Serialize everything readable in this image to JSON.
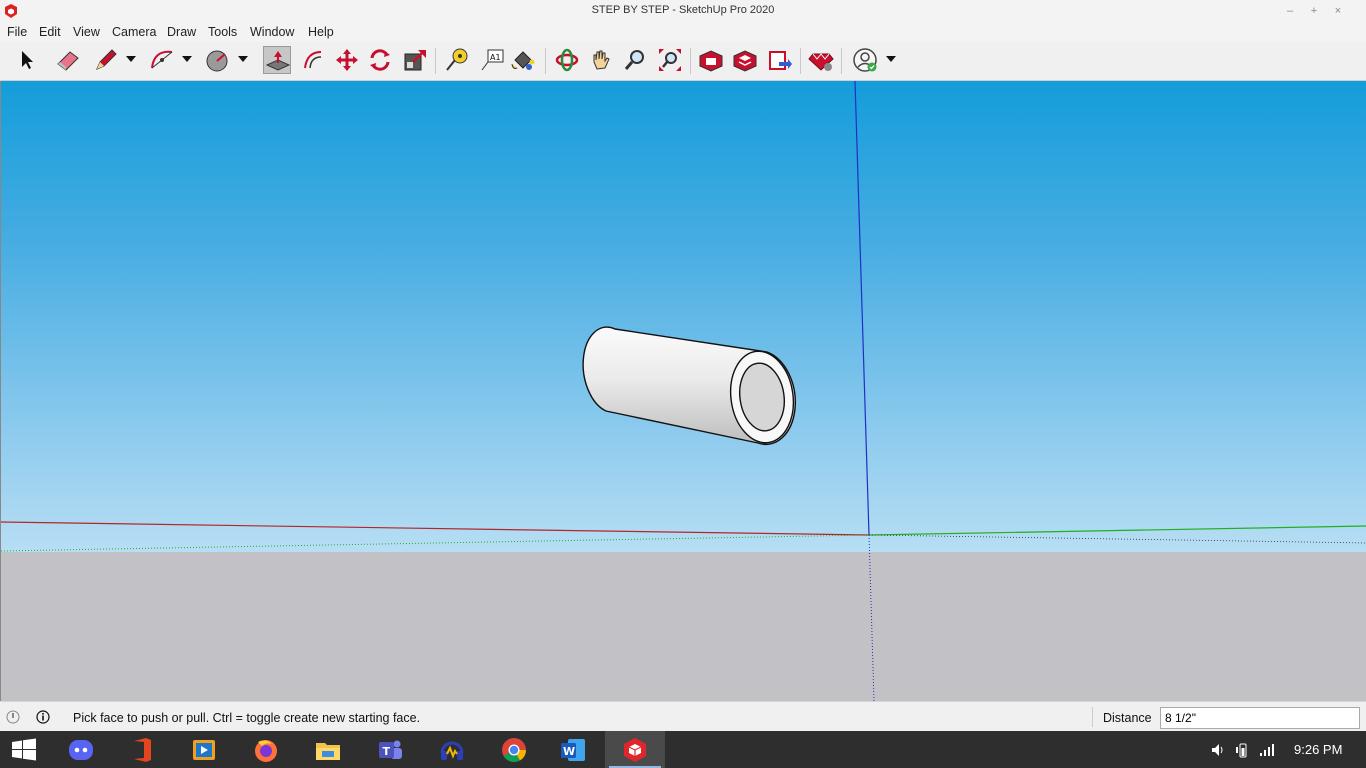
{
  "window": {
    "title": "STEP BY STEP - SketchUp Pro 2020"
  },
  "menu": [
    "File",
    "Edit",
    "View",
    "Camera",
    "Draw",
    "Tools",
    "Window",
    "Help"
  ],
  "toolbar": {
    "tools": [
      {
        "name": "select",
        "icon": "select-arrow-icon"
      },
      {
        "name": "eraser",
        "icon": "eraser-icon"
      },
      {
        "name": "line",
        "icon": "pencil-icon"
      },
      {
        "name": "arc",
        "icon": "arc-icon"
      },
      {
        "name": "shapes",
        "icon": "circle-shape-icon"
      },
      {
        "name": "push-pull",
        "icon": "push-pull-icon",
        "active": true
      },
      {
        "name": "offset",
        "icon": "offset-icon"
      },
      {
        "name": "move",
        "icon": "move-icon"
      },
      {
        "name": "rotate",
        "icon": "rotate-icon"
      },
      {
        "name": "scale",
        "icon": "scale-icon"
      },
      {
        "name": "tape-measure",
        "icon": "tape-measure-icon"
      },
      {
        "name": "text",
        "icon": "text-icon"
      },
      {
        "name": "paint-bucket",
        "icon": "paint-bucket-icon"
      },
      {
        "name": "orbit",
        "icon": "orbit-icon"
      },
      {
        "name": "pan",
        "icon": "pan-hand-icon"
      },
      {
        "name": "zoom",
        "icon": "zoom-icon"
      },
      {
        "name": "zoom-extents",
        "icon": "zoom-extents-icon"
      },
      {
        "name": "3d-warehouse",
        "icon": "warehouse-icon"
      },
      {
        "name": "extension-warehouse",
        "icon": "extension-warehouse-icon"
      },
      {
        "name": "send-to-layout",
        "icon": "layout-icon"
      },
      {
        "name": "extension-manager",
        "icon": "ruby-icon"
      },
      {
        "name": "account",
        "icon": "account-icon"
      }
    ]
  },
  "status": {
    "hint": "Pick face to push or pull.  Ctrl = toggle create new starting face.",
    "vcb_label": "Distance",
    "vcb_value": "8 1/2\""
  },
  "taskbar": {
    "apps": [
      "discord-icon",
      "office-icon",
      "media-player-icon",
      "firefox-icon",
      "file-explorer-icon",
      "teams-icon",
      "audio-app-icon",
      "chrome-icon",
      "word-icon",
      "sketchup-icon"
    ],
    "active_app": "sketchup-icon",
    "clock": "9:26 PM"
  },
  "colors": {
    "axis_blue": "#1f2fc8",
    "axis_red": "#b3262a",
    "axis_green": "#20b020",
    "sky_top": "#149dda",
    "ground": "#c2c2c6"
  }
}
